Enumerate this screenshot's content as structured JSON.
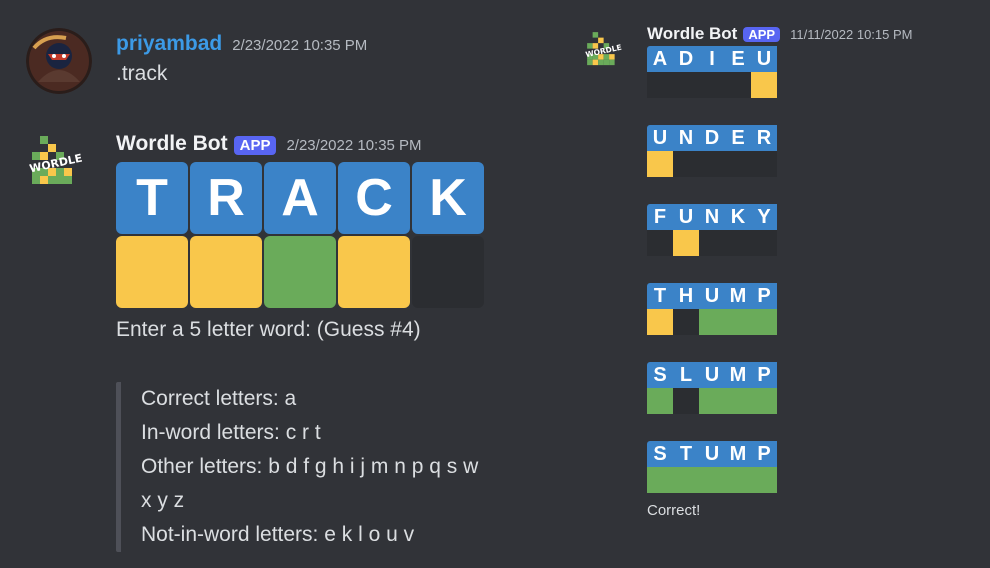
{
  "colors": {
    "background": "#313338",
    "username_blue": "#3c9ae6",
    "tile_blue": "#3b83c8",
    "tile_yellow": "#f9c74b",
    "tile_green": "#6aab5a",
    "tile_empty": "#2b2d31",
    "app_badge": "#5865f2"
  },
  "left": {
    "user_message": {
      "username": "priyambad",
      "timestamp": "2/23/2022 10:35 PM",
      "text": ".track"
    },
    "bot_message": {
      "username": "Wordle Bot",
      "badge": "APP",
      "timestamp": "2/23/2022 10:35 PM",
      "avatar_label": "WORDLE",
      "board": {
        "letters": [
          "T",
          "R",
          "A",
          "C",
          "K"
        ],
        "result": [
          "yellow",
          "yellow",
          "green",
          "yellow",
          "empty"
        ]
      },
      "prompt": "Enter a 5 letter word: (Guess #4)",
      "stats": {
        "correct": "Correct letters: a",
        "in_word": "In-word letters: c r t",
        "other": "Other letters: b d f g h i j m n p q s w x y z",
        "not_in_word": "Not-in-word letters: e k l o u v"
      }
    }
  },
  "right": {
    "username": "Wordle Bot",
    "badge": "APP",
    "timestamp": "11/11/2022 10:15 PM",
    "avatar_label": "WORDLE",
    "boards": [
      {
        "letters": [
          "A",
          "D",
          "I",
          "E",
          "U"
        ],
        "result": [
          "empty",
          "empty",
          "empty",
          "empty",
          "yellow"
        ]
      },
      {
        "letters": [
          "U",
          "N",
          "D",
          "E",
          "R"
        ],
        "result": [
          "yellow",
          "empty",
          "empty",
          "empty",
          "empty"
        ]
      },
      {
        "letters": [
          "F",
          "U",
          "N",
          "K",
          "Y"
        ],
        "result": [
          "empty",
          "yellow",
          "empty",
          "empty",
          "empty"
        ]
      },
      {
        "letters": [
          "T",
          "H",
          "U",
          "M",
          "P"
        ],
        "result": [
          "yellow",
          "empty",
          "green",
          "green",
          "green"
        ]
      },
      {
        "letters": [
          "S",
          "L",
          "U",
          "M",
          "P"
        ],
        "result": [
          "green",
          "empty",
          "green",
          "green",
          "green"
        ]
      },
      {
        "letters": [
          "S",
          "T",
          "U",
          "M",
          "P"
        ],
        "result": [
          "green",
          "green",
          "green",
          "green",
          "green"
        ]
      }
    ],
    "final_text": "Correct!"
  }
}
